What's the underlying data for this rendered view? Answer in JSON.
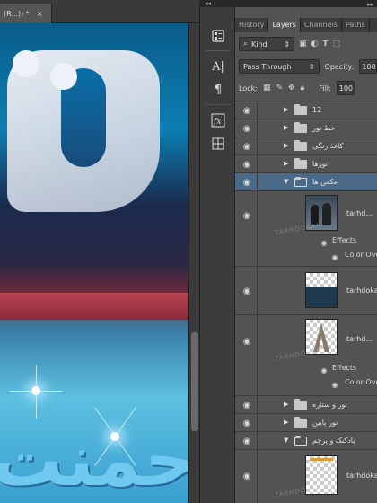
{
  "document": {
    "tab_title": "(R...)) *",
    "tab_close": "×"
  },
  "toolstrip": {
    "collapse_glyph": "◂◂",
    "tools": [
      "properties-icon",
      "character-icon",
      "paragraph-icon",
      "styles-fx-icon",
      "grid-icon"
    ]
  },
  "panel": {
    "collapse_glyph": "▸▸",
    "tabs": [
      "History",
      "Layers",
      "Channels",
      "Paths"
    ],
    "active_tab": "Layers",
    "filter": {
      "kind_label": "Kind"
    },
    "blend": {
      "mode": "Pass Through",
      "opacity_label": "Opacity:",
      "opacity_value": "100"
    },
    "lock": {
      "lock_label": "Lock:",
      "fill_label": "Fill:",
      "fill_value": "100"
    }
  },
  "layers": [
    {
      "type": "group",
      "name": "12",
      "expanded": false
    },
    {
      "type": "group",
      "name": "خط نور",
      "expanded": false
    },
    {
      "type": "group",
      "name": "کاغذ رنگی",
      "expanded": false
    },
    {
      "type": "group",
      "name": "نورها",
      "expanded": false
    },
    {
      "type": "group",
      "name": "عکس ها",
      "expanded": true,
      "selected": true
    },
    {
      "type": "layer",
      "name": "tarhd...",
      "effects": [
        "Effects",
        "Color Ove"
      ]
    },
    {
      "type": "layer",
      "name": "tarhdoka"
    },
    {
      "type": "layer",
      "name": "tarhd...",
      "effects": [
        "Effects",
        "Color Ove"
      ]
    },
    {
      "type": "group",
      "name": "نور و ستاره",
      "expanded": false
    },
    {
      "type": "group",
      "name": "نور پایین",
      "expanded": false
    },
    {
      "type": "group",
      "name": "بادکنک و پرچم",
      "expanded": true
    },
    {
      "type": "layer",
      "name": "tarhdoka"
    }
  ],
  "watermark": "TARHDOKAN"
}
